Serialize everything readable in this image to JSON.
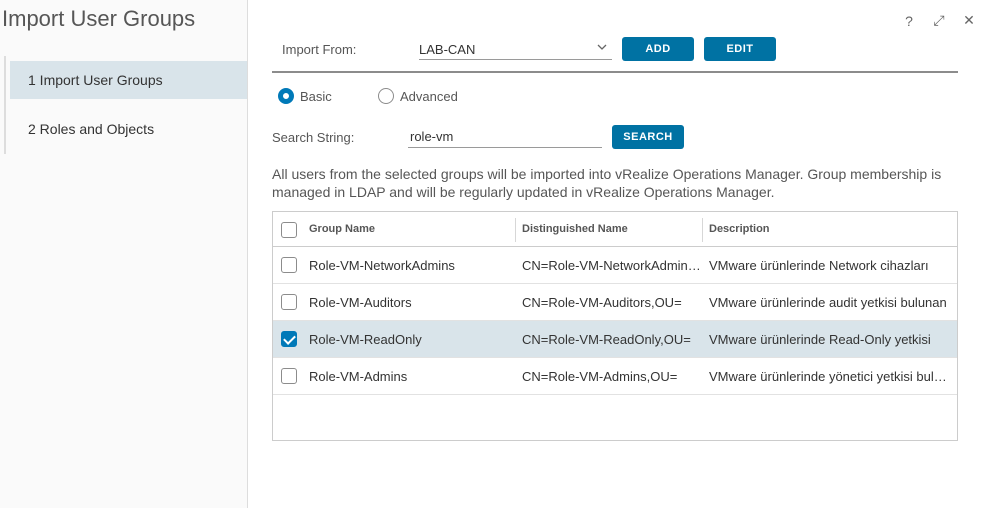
{
  "wizard": {
    "title": "Import User Groups",
    "steps": [
      {
        "label": "1  Import User Groups",
        "active": true
      },
      {
        "label": "2  Roles and Objects",
        "active": false
      }
    ]
  },
  "window_controls": {
    "help": "?",
    "expand": "⤢",
    "close": "✕"
  },
  "import_from": {
    "label": "Import From:",
    "selected": "LAB-CAN",
    "add_label": "ADD",
    "edit_label": "EDIT"
  },
  "search_mode": {
    "basic_label": "Basic",
    "advanced_label": "Advanced",
    "selected": "basic"
  },
  "search": {
    "label": "Search String:",
    "value": "role-vm",
    "button_label": "SEARCH"
  },
  "info_text": "All users from the selected groups will be imported into vRealize Operations Manager. Group membership is managed in LDAP and will be regularly updated in vRealize Operations Manager.",
  "grid": {
    "columns": [
      "Group Name",
      "Distinguished Name",
      "Description"
    ],
    "rows": [
      {
        "name": "Role-VM-NetworkAdmins",
        "dn": "CN=Role-VM-NetworkAdmins,OU=",
        "description": "VMware ürünlerinde Network cihazları",
        "checked": false
      },
      {
        "name": "Role-VM-Auditors",
        "dn": "CN=Role-VM-Auditors,OU=",
        "description": "VMware ürünlerinde audit yetkisi bulunan",
        "checked": false
      },
      {
        "name": "Role-VM-ReadOnly",
        "dn": "CN=Role-VM-ReadOnly,OU=",
        "description": "VMware ürünlerinde Read-Only yetkisi",
        "checked": true
      },
      {
        "name": "Role-VM-Admins",
        "dn": "CN=Role-VM-Admins,OU=",
        "description": "VMware ürünlerinde yönetici yetkisi bulunan",
        "checked": false
      }
    ]
  },
  "colors": {
    "accent": "#0072a3",
    "selected_row": "#d9e4ea"
  }
}
